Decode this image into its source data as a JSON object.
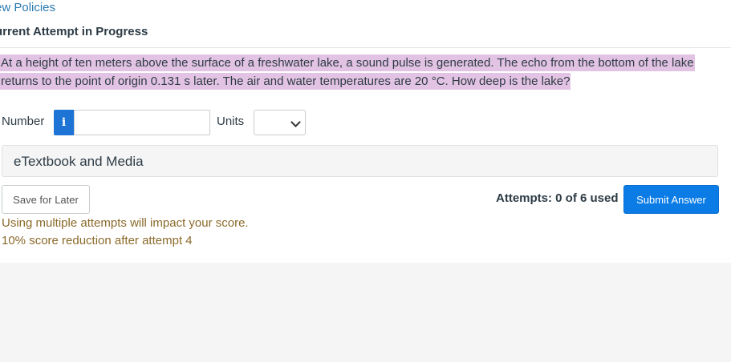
{
  "nav": {
    "policies_link": "ew Policies"
  },
  "attempt": {
    "heading": "urrent Attempt in Progress"
  },
  "question": {
    "text": "At a height of ten meters above the surface of a freshwater lake, a sound pulse is generated. The echo from the bottom of the lake returns to the point of origin 0.131 s later. The air and water temperatures are 20 °C. How deep is the lake?"
  },
  "answer": {
    "number_label": "Number",
    "info_icon": "i",
    "number_value": "",
    "units_label": "Units",
    "units_selected": ""
  },
  "etextbook": {
    "label": "eTextbook and Media"
  },
  "actions": {
    "save_label": "Save for Later",
    "attempts_text": "Attempts: 0 of 6 used",
    "submit_label": "Submit Answer"
  },
  "notices": {
    "line1": "Using multiple attempts will impact your score.",
    "line2": "10% score reduction after attempt 4"
  },
  "colors": {
    "accent": "#0b7ce6",
    "highlight": "#e3c3e3",
    "warning_text": "#8b6a2b",
    "link": "#2a7ab0"
  }
}
